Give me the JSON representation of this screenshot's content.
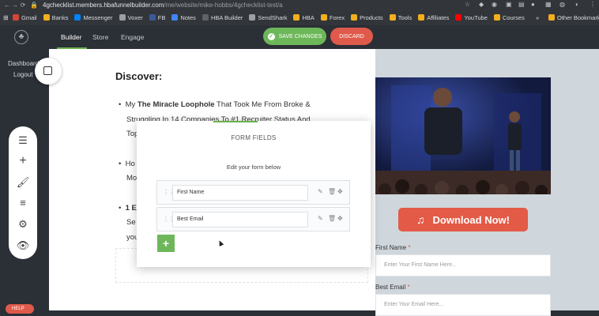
{
  "browser": {
    "url_host": "4gchecklist.members.hbafunnelbuilder.com",
    "url_path": "/me/website/mike-hobbs/4gchecklist-test/a",
    "bookmarks": [
      {
        "label": "Gmail",
        "color": "#d44638"
      },
      {
        "label": "Banks",
        "color": "#f2b01e"
      },
      {
        "label": "Messenger",
        "color": "#0084ff"
      },
      {
        "label": "Voxer",
        "color": "#9aa0a6"
      },
      {
        "label": "FB",
        "color": "#3b5998"
      },
      {
        "label": "Notes",
        "color": "#4285f4"
      },
      {
        "label": "HBA Builder",
        "color": "#5f6368"
      },
      {
        "label": "SendShark",
        "color": "#9aa0a6"
      },
      {
        "label": "HBA",
        "color": "#f2b01e"
      },
      {
        "label": "Forex",
        "color": "#f2b01e"
      },
      {
        "label": "Products",
        "color": "#f2b01e"
      },
      {
        "label": "Tools",
        "color": "#f2b01e"
      },
      {
        "label": "Affiliates",
        "color": "#f2b01e"
      },
      {
        "label": "YouTube",
        "color": "#ff0000"
      },
      {
        "label": "Courses",
        "color": "#f2b01e"
      }
    ],
    "other_bookmarks": "Other Bookmarks",
    "more_chevron": "»"
  },
  "app": {
    "tabs": [
      "Builder",
      "Store",
      "Engage"
    ],
    "save_label": "SAVE CHANGES",
    "discard_label": "DISCARD"
  },
  "sidebar": {
    "dashboard": "Dashboard",
    "logout": "Logout",
    "help": "HELP"
  },
  "page": {
    "heading": "Discover:",
    "bullets": [
      {
        "prefix": "My ",
        "bold": "The Miracle Loophole",
        "rest": " That Took Me From Broke &"
      },
      {
        "line": "Struggling In 14 Companies To #1 Recruiter Status And"
      },
      {
        "line": "Top"
      },
      {
        "line": "Ho"
      },
      {
        "line": "Mo"
      },
      {
        "bold": "1 E"
      },
      {
        "line": "Se"
      },
      {
        "line": "you"
      }
    ]
  },
  "optin": {
    "download_label": "Download Now!",
    "first_name_label": "First Name",
    "first_name_placeholder": "Enter Your First Name Here...",
    "email_label": "Best Email",
    "email_placeholder": "Enter Your Email Here...",
    "required_mark": "*"
  },
  "modal": {
    "title": "FORM FIELDS",
    "subtitle": "Edit your form below",
    "fields": [
      "First Name",
      "Best Email"
    ],
    "add_label": "+"
  },
  "colors": {
    "accent_green": "#6db75a",
    "danger_red": "#e05a4b",
    "download_red": "#e35a47"
  }
}
